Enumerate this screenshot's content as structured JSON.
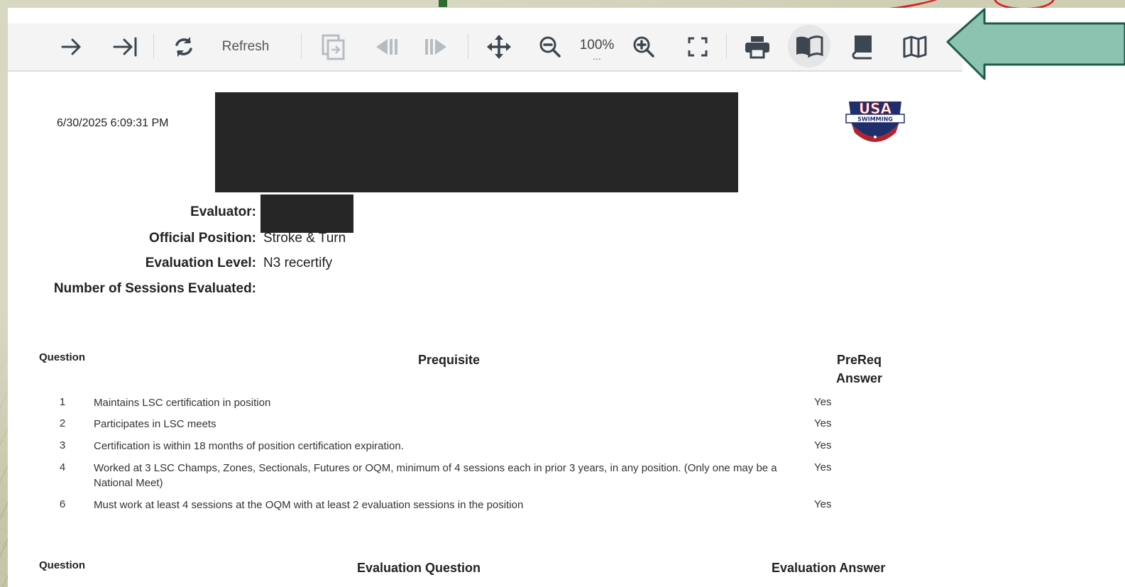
{
  "toolbar": {
    "refresh_label": "Refresh",
    "zoom_level": "100%",
    "zoom_dots": "...",
    "icons": [
      "next-page-icon",
      "last-page-icon",
      "refresh-icon",
      "export-icon",
      "prev-step-icon",
      "next-step-icon",
      "pan-icon",
      "zoom-out-icon",
      "zoom-in-icon",
      "fullscreen-icon",
      "print-icon",
      "book-open-icon",
      "book-stack-icon",
      "map-icon"
    ]
  },
  "report": {
    "timestamp": "6/30/2025 6:09:31 PM",
    "logo_text": "USA",
    "logo_subtext": "SWIMMING",
    "fields": {
      "evaluator_label": "Evaluator:",
      "position_label": "Official Position:",
      "position_value": "Stroke & Turn",
      "level_label": "Evaluation Level:",
      "level_value": "N3 recertify",
      "sessions_label": "Number of Sessions Evaluated:"
    },
    "prereq_table": {
      "col_question": "Question",
      "col_prereq": "Prequisite",
      "col_answer_line1": "PreReq",
      "col_answer_line2": "Answer",
      "rows": [
        {
          "num": "1",
          "text": "Maintains LSC certification in position",
          "answer": "Yes"
        },
        {
          "num": "2",
          "text": "Participates in LSC meets",
          "answer": "Yes"
        },
        {
          "num": "3",
          "text": "Certification is within 18 months of position certification expiration.",
          "answer": "Yes"
        },
        {
          "num": "4",
          "text": "Worked at 3 LSC Champs, Zones, Sectionals, Futures or OQM, minimum of 4 sessions each in prior 3 years, in any position. (Only one may be a National Meet)",
          "answer": "Yes"
        },
        {
          "num": "6",
          "text": "Must work at least 4 sessions at the OQM with at least 2 evaluation sessions in the position",
          "answer": "Yes"
        }
      ]
    },
    "eval_table": {
      "col_question": "Question",
      "col_eval_question": "Evaluation Question",
      "col_eval_answer": "Evaluation Answer"
    }
  },
  "colors": {
    "callout_fill": "#8cc2b0",
    "callout_stroke": "#1f5b4a",
    "redaction": "#262626"
  }
}
